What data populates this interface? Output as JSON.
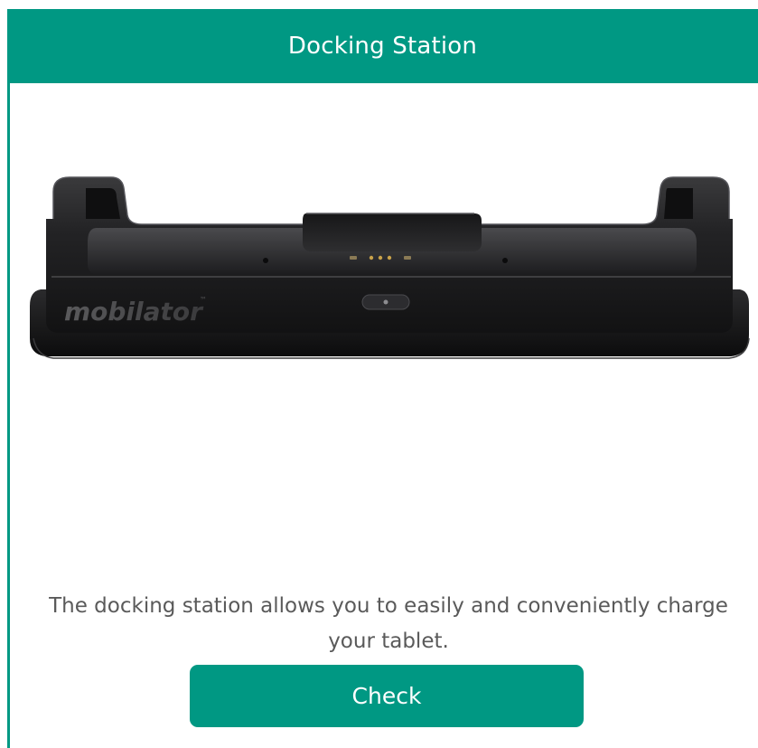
{
  "header": {
    "title": "Docking Station"
  },
  "product_image": {
    "watermark_text": "mobilator",
    "watermark_mark": "™"
  },
  "description": "The docking station allows you to easily and conveniently charge your tablet.",
  "button": {
    "label": "Check"
  },
  "colors": {
    "accent": "#009883",
    "text": "#5a5a5a",
    "background": "#ffffff"
  }
}
